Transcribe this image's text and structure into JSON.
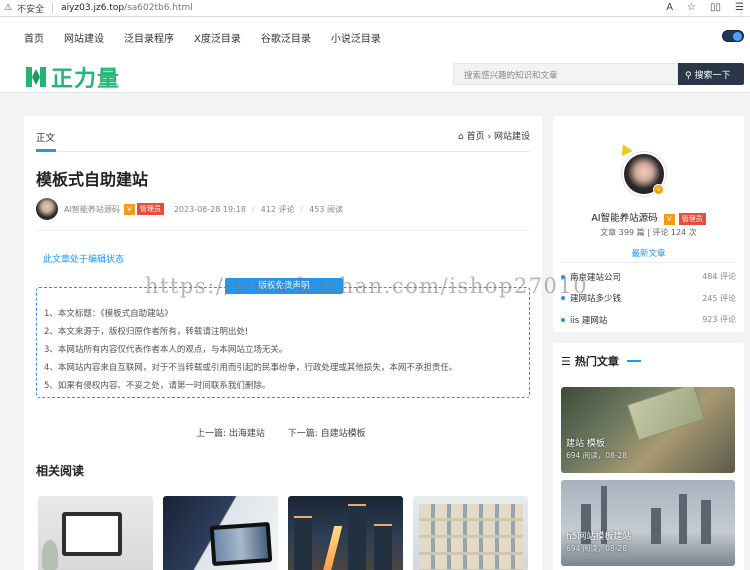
{
  "browser": {
    "insecure_label": "不安全",
    "url_host": "aiyz03.jz6.top",
    "url_path": "/sa602tb6.html"
  },
  "nav": {
    "items": [
      "首页",
      "网站建设",
      "泛目录程序",
      "X度泛目录",
      "谷歌泛目录",
      "小说泛目录"
    ]
  },
  "site": {
    "logo_text": "正力量",
    "brand_color": "#22b573",
    "search_placeholder": "搜索感兴趣的知识和文章",
    "search_button": "搜索一下"
  },
  "article": {
    "tab_label": "正文",
    "breadcrumb": [
      "首页",
      "网站建设"
    ],
    "title": "模板式自助建站",
    "author": "AI智能养站源码",
    "vip_badge": "V",
    "role_badge": "管理员",
    "date": "2023-08-28 19:18",
    "comments": "412 评论",
    "views": "453 阅读",
    "status_text": "此文章处于编辑状态",
    "notice_title": "版权免责声明",
    "notice_items": [
      "1、本文标题：《模板式自助建站》",
      "2、本文来源于，版权归原作者所有，转载请注明出处!",
      "3、本网站所有内容仅代表作者本人的观点，与本网站立场无关。",
      "4、本网站内容来自互联网，对于不当转载或引用而引起的民事纷争，行政处理或其他损失，本网不承担责任。",
      "5、如果有侵权内容、不妥之处，请第一时间联系我们删除。"
    ],
    "prev_label": "上一篇: 出海建站",
    "next_label": "下一篇: 自建站模板",
    "related_heading": "相关阅读"
  },
  "sidebar": {
    "name": "AI智能养站源码",
    "vip_badge": "V",
    "role_badge": "管理员",
    "stats": "文章 399 篇 | 评论 124 次",
    "newest_label": "最新文章",
    "newest": [
      {
        "title": "南京建站公司",
        "count": "484 评论"
      },
      {
        "title": "建网站多少钱",
        "count": "245 评论"
      },
      {
        "title": "iis 建网站",
        "count": "923 评论"
      }
    ],
    "hot_heading": "热门文章",
    "hot": [
      {
        "title": "建站 模板",
        "meta": "694 阅读，08-28"
      },
      {
        "title": "h5网站模板建站",
        "meta": "694 阅读，08-28"
      }
    ]
  },
  "watermark": "https://www.huzhan.com/ishop27010"
}
